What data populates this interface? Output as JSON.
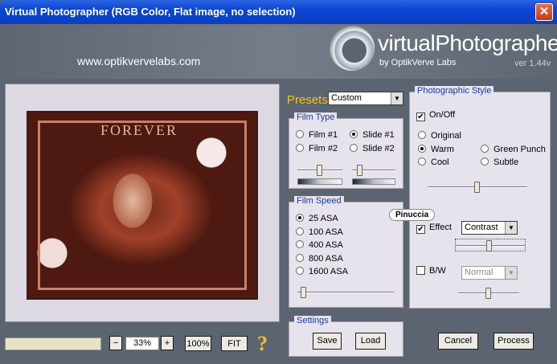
{
  "window": {
    "title": "Virtual Photographer (RGB Color, Flat image, no selection)",
    "close": "✕"
  },
  "header": {
    "site": "www.optikvervelabs.com",
    "logo": "virtualPhotographer",
    "byline": "by OptikVerve Labs",
    "version": "ver 1.44v"
  },
  "preview": {
    "image_text": "FOREVER"
  },
  "zoom": {
    "minus": "−",
    "value": "33%",
    "plus": "+",
    "hundred": "100%",
    "fit": "FIT",
    "help": "?"
  },
  "presets": {
    "label": "Presets",
    "value": "Custom"
  },
  "film_type": {
    "title": "Film Type",
    "options": [
      {
        "label": "Film #1",
        "selected": false
      },
      {
        "label": "Slide #1",
        "selected": true
      },
      {
        "label": "Film #2",
        "selected": false
      },
      {
        "label": "Slide #2",
        "selected": false
      }
    ]
  },
  "film_speed": {
    "title": "Film Speed",
    "options": [
      {
        "label": "25 ASA",
        "selected": true
      },
      {
        "label": "100 ASA",
        "selected": false
      },
      {
        "label": "400 ASA",
        "selected": false
      },
      {
        "label": "800 ASA",
        "selected": false
      },
      {
        "label": "1600 ASA",
        "selected": false
      }
    ]
  },
  "style": {
    "title": "Photographic Style",
    "onoff": {
      "label": "On/Off",
      "checked": true
    },
    "options": [
      {
        "label": "Original",
        "selected": false
      },
      {
        "label": "Warm",
        "selected": true
      },
      {
        "label": "Green Punch",
        "selected": false
      },
      {
        "label": "Cool",
        "selected": false
      },
      {
        "label": "Subtle",
        "selected": false
      }
    ],
    "watermark": "Pinuccia",
    "effect": {
      "label": "Effect",
      "checked": true,
      "value": "Contrast"
    },
    "bw": {
      "label": "B/W",
      "checked": false,
      "value": "Normal"
    }
  },
  "settings": {
    "title": "Settings",
    "save": "Save",
    "load": "Load"
  },
  "actions": {
    "cancel": "Cancel",
    "process": "Process"
  },
  "colors": {
    "title_bar": "#0a46d4",
    "accent": "#f5c518",
    "legend": "#1b3aa0",
    "panel": "#e6e3ec"
  }
}
